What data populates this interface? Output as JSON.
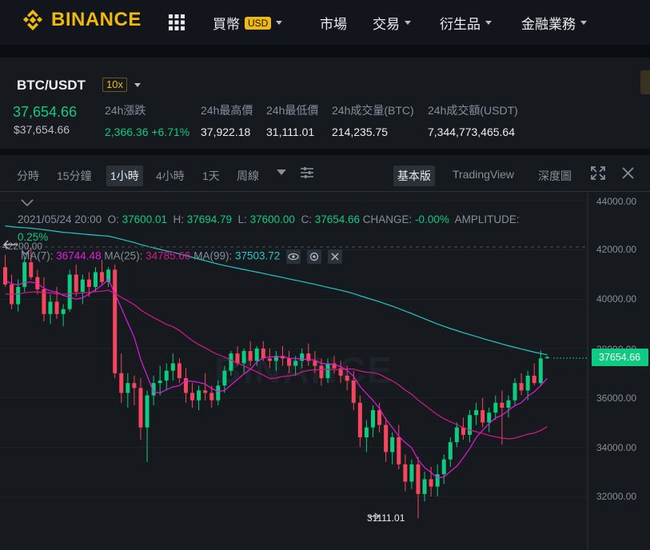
{
  "nav": {
    "logo_text": "BINANCE",
    "items": [
      {
        "label": "買幣",
        "badge": "USD",
        "has_caret": true
      },
      {
        "label": "市場",
        "has_caret": false
      },
      {
        "label": "交易",
        "has_caret": true
      },
      {
        "label": "衍生品",
        "has_caret": true
      },
      {
        "label": "金融業務",
        "has_caret": true
      }
    ]
  },
  "ticker": {
    "pair": "BTC/USDT",
    "leverage": "10x",
    "last_price": "37,654.66",
    "last_price_usd": "$37,654.66",
    "stats": [
      {
        "label": "24h漲跌",
        "value": "2,366.36 +6.71%",
        "color": "#0ecb81"
      },
      {
        "label": "24h最高價",
        "value": "37,922.18"
      },
      {
        "label": "24h最低價",
        "value": "31,111.01"
      },
      {
        "label": "24h成交量(BTC)",
        "value": "214,235.75"
      },
      {
        "label": "24h成交額(USDT)",
        "value": "7,344,773,465.64"
      }
    ]
  },
  "toolbar": {
    "intervals": [
      "分時",
      "15分鐘",
      "1小時",
      "4小時",
      "1天",
      "周線"
    ],
    "active_interval": "1小時",
    "views": [
      "基本版",
      "TradingView",
      "深度圖"
    ],
    "active_view": "基本版"
  },
  "chart_info": {
    "datetime": "2021/05/24 20:00",
    "open_label": "O:",
    "open": "37600.01",
    "high_label": "H:",
    "high": "37694.79",
    "low_label": "L:",
    "low": "37600.00",
    "close_label": "C:",
    "close": "37654.66",
    "change_label": "CHANGE:",
    "change": "-0.00%",
    "amplitude_label": "AMPLITUDE:",
    "amplitude": "0.25%",
    "ma7_label": "MA(7):",
    "ma7": "36744.48",
    "ma25_label": "MA(25):",
    "ma25": "34785.66",
    "ma99_label": "MA(99):",
    "ma99": "37503.72",
    "hover_price": "42200.00",
    "current_price_tag": "37654.66",
    "low_marker": "31111.01"
  },
  "colors": {
    "up": "#0ecb81",
    "down": "#f6465d",
    "ma7": "#e31ae0",
    "ma25": "#d51a8c",
    "ma99": "#22c7c7",
    "brand": "#f0b90b"
  },
  "chart_data": {
    "type": "candlestick",
    "y_ticks": [
      "44000.00",
      "42000.00",
      "40000.00",
      "38000.00",
      "36000.00",
      "34000.00",
      "32000.00"
    ],
    "ylim": [
      30800,
      44400
    ],
    "watermark": "BINANCE",
    "candles": [
      [
        41300,
        41800,
        40500,
        40600
      ],
      [
        40600,
        41000,
        39600,
        39800
      ],
      [
        39800,
        40800,
        39500,
        40500
      ],
      [
        40500,
        41700,
        40300,
        41500
      ],
      [
        41500,
        42100,
        40800,
        40900
      ],
      [
        40900,
        41200,
        40200,
        40400
      ],
      [
        40400,
        40900,
        39100,
        39400
      ],
      [
        39400,
        40200,
        39000,
        39900
      ],
      [
        39900,
        40500,
        39200,
        39400
      ],
      [
        39400,
        39800,
        38900,
        39600
      ],
      [
        39600,
        41200,
        39500,
        41000
      ],
      [
        41000,
        41400,
        40100,
        40300
      ],
      [
        40300,
        41000,
        39800,
        40800
      ],
      [
        40800,
        41100,
        40100,
        40500
      ],
      [
        40500,
        41300,
        40300,
        41100
      ],
      [
        41100,
        41600,
        40600,
        40700
      ],
      [
        40700,
        41300,
        40500,
        41200
      ],
      [
        41200,
        41400,
        36800,
        37000
      ],
      [
        37000,
        37800,
        35800,
        36200
      ],
      [
        36200,
        37000,
        35600,
        36600
      ],
      [
        36600,
        36900,
        35700,
        36400
      ],
      [
        36400,
        36800,
        34300,
        34800
      ],
      [
        34800,
        36300,
        33400,
        36100
      ],
      [
        36100,
        36900,
        35700,
        36600
      ],
      [
        36600,
        37300,
        36100,
        36700
      ],
      [
        36700,
        37400,
        36300,
        37100
      ],
      [
        37100,
        37800,
        36700,
        37400
      ],
      [
        37400,
        37600,
        36600,
        36800
      ],
      [
        36800,
        37200,
        35800,
        36200
      ],
      [
        36200,
        36600,
        35600,
        35900
      ],
      [
        35900,
        36500,
        35500,
        36300
      ],
      [
        36300,
        37000,
        35900,
        36200
      ],
      [
        36200,
        36500,
        35600,
        35900
      ],
      [
        35900,
        36700,
        35700,
        36500
      ],
      [
        36500,
        37300,
        36200,
        37100
      ],
      [
        37100,
        37900,
        36900,
        37800
      ],
      [
        37800,
        38100,
        37300,
        37400
      ],
      [
        37400,
        38000,
        37000,
        37900
      ],
      [
        37900,
        38300,
        37300,
        37500
      ],
      [
        37500,
        38100,
        37300,
        38000
      ],
      [
        38000,
        38300,
        37500,
        37600
      ],
      [
        37600,
        38000,
        37200,
        37500
      ],
      [
        37500,
        37900,
        37100,
        37700
      ],
      [
        37700,
        38100,
        37300,
        37600
      ],
      [
        37600,
        37900,
        37000,
        37300
      ],
      [
        37300,
        37700,
        36900,
        37500
      ],
      [
        37500,
        38000,
        37200,
        37800
      ],
      [
        37800,
        38200,
        37300,
        37500
      ],
      [
        37500,
        37900,
        37000,
        37300
      ],
      [
        37300,
        37600,
        36500,
        36800
      ],
      [
        36800,
        37600,
        36600,
        37400
      ],
      [
        37400,
        37700,
        37000,
        37200
      ],
      [
        37200,
        37500,
        36600,
        36900
      ],
      [
        36900,
        37300,
        36300,
        36700
      ],
      [
        36700,
        37100,
        35500,
        35800
      ],
      [
        35800,
        36100,
        34000,
        34400
      ],
      [
        34400,
        35100,
        33800,
        34800
      ],
      [
        34800,
        35700,
        34400,
        35500
      ],
      [
        35500,
        35800,
        34600,
        34900
      ],
      [
        34900,
        35200,
        33400,
        33800
      ],
      [
        33800,
        34600,
        33300,
        34400
      ],
      [
        34400,
        34900,
        33100,
        33300
      ],
      [
        33300,
        33700,
        32200,
        32600
      ],
      [
        32600,
        33500,
        32300,
        33300
      ],
      [
        33300,
        33600,
        31111,
        32100
      ],
      [
        32100,
        33000,
        31800,
        32700
      ],
      [
        32700,
        33200,
        32000,
        32400
      ],
      [
        32400,
        33300,
        32000,
        32900
      ],
      [
        32900,
        33700,
        32500,
        33500
      ],
      [
        33500,
        34400,
        33200,
        34200
      ],
      [
        34200,
        35000,
        34000,
        34800
      ],
      [
        34800,
        35200,
        34300,
        34500
      ],
      [
        34500,
        35500,
        34200,
        35300
      ],
      [
        35300,
        35800,
        34900,
        35500
      ],
      [
        35500,
        36000,
        34800,
        35000
      ],
      [
        35000,
        35600,
        34600,
        35400
      ],
      [
        35400,
        36100,
        35100,
        35800
      ],
      [
        35800,
        36300,
        34100,
        35600
      ],
      [
        35600,
        36100,
        35200,
        35900
      ],
      [
        35900,
        36800,
        35700,
        36600
      ],
      [
        36600,
        37000,
        36100,
        36300
      ],
      [
        36300,
        37100,
        35900,
        36900
      ],
      [
        36900,
        37400,
        36500,
        36600
      ],
      [
        36600,
        37922,
        36500,
        37600
      ],
      [
        37600,
        37695,
        37600,
        37655
      ]
    ]
  }
}
